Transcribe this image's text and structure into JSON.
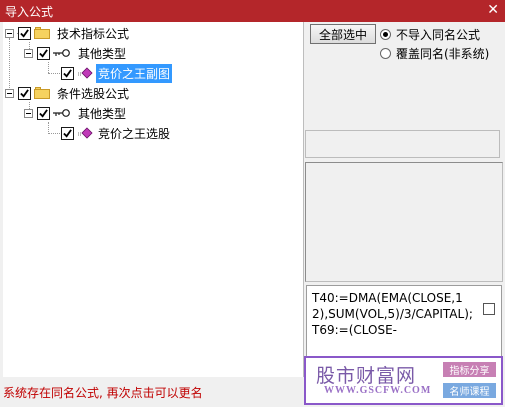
{
  "window": {
    "title": "导入公式",
    "close_glyph": "✕"
  },
  "tree": {
    "nodes": [
      {
        "label": "技术指标公式",
        "checked": true,
        "icon": "folder-icon"
      },
      {
        "label": "其他类型",
        "checked": true,
        "icon": "key-icon"
      },
      {
        "label": "竞价之王副图",
        "checked": true,
        "icon": "gem-icon",
        "selected": true
      },
      {
        "label": "条件选股公式",
        "checked": true,
        "icon": "folder-icon"
      },
      {
        "label": "其他类型",
        "checked": true,
        "icon": "key-icon"
      },
      {
        "label": "竞价之王选股",
        "checked": true,
        "icon": "gem-icon"
      }
    ]
  },
  "options": {
    "select_all_label": "全部选中",
    "radio_no_import": "不导入同名公式",
    "radio_overwrite": "覆盖同名(非系统)",
    "selected_radio": "不导入同名公式"
  },
  "code_preview": "T40:=DMA(EMA(CLOSE,12),SUM(VOL,5)/3/CAPITAL);\nT69:=(CLOSE-",
  "status_message": "系统存在同名公式, 再次点击可以更名",
  "watermark": {
    "title": "股市财富网",
    "url": "WWW.GSCFW.COM",
    "tag1": "指标分享",
    "tag2": "名师课程"
  },
  "colors": {
    "titlebar": "#b4262a",
    "selection": "#3399ff",
    "status_text": "#c00000"
  }
}
